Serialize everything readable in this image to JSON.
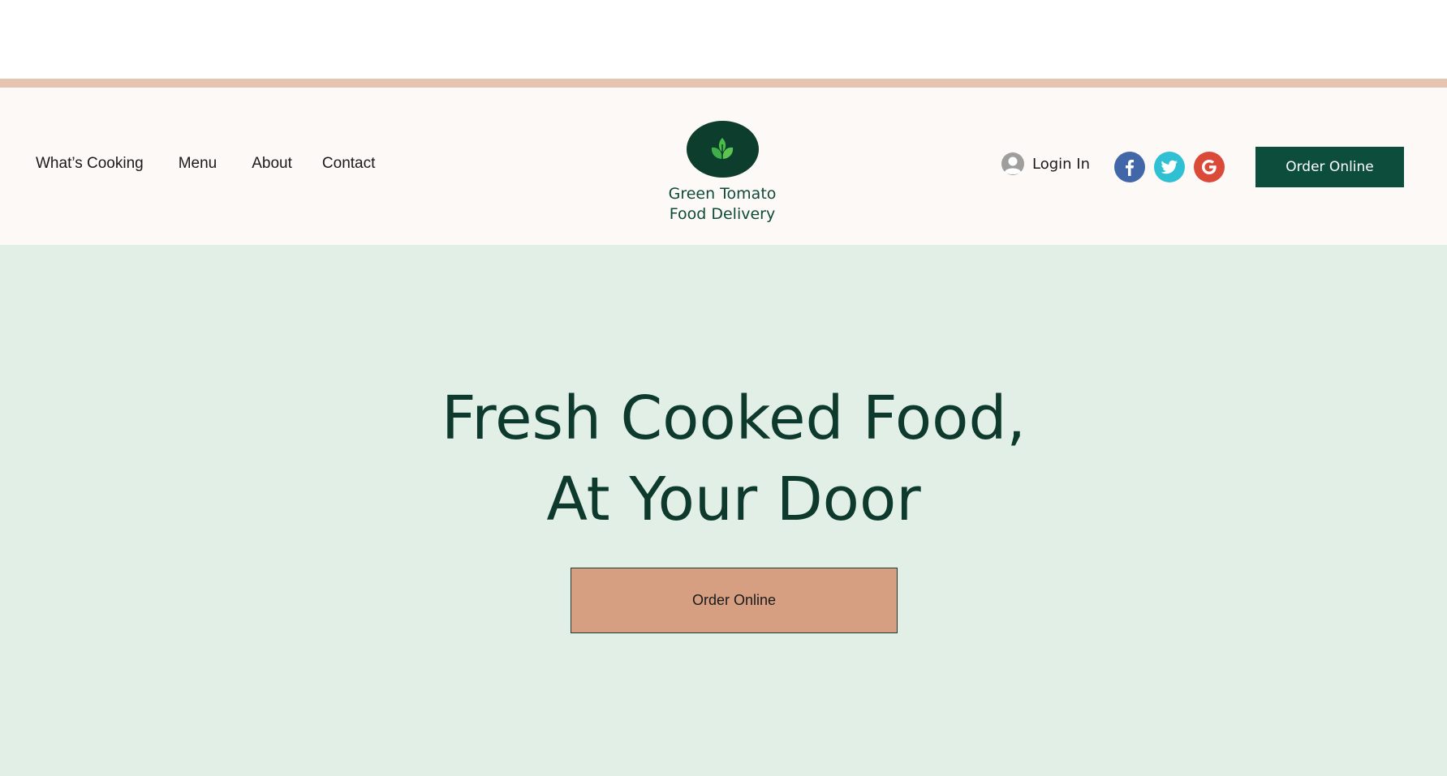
{
  "nav": {
    "items": [
      {
        "label": "What’s Cooking"
      },
      {
        "label": "Menu"
      },
      {
        "label": "About"
      },
      {
        "label": "Contact"
      }
    ]
  },
  "brand": {
    "line1": "Green Tomato",
    "line2": "Food Delivery"
  },
  "header": {
    "login_label": "Login In",
    "order_button": "Order Online"
  },
  "social": [
    {
      "icon": "facebook-icon"
    },
    {
      "icon": "twitter-icon"
    },
    {
      "icon": "google-icon"
    }
  ],
  "hero": {
    "title_line1": "Fresh Cooked Food,",
    "title_line2": "At Your Door",
    "cta": "Order Online"
  },
  "colors": {
    "brand_green": "#0d4d3c",
    "hero_bg": "#e2efe6",
    "cta_bg": "#d69f82",
    "accent_border": "#e6c5b0"
  }
}
